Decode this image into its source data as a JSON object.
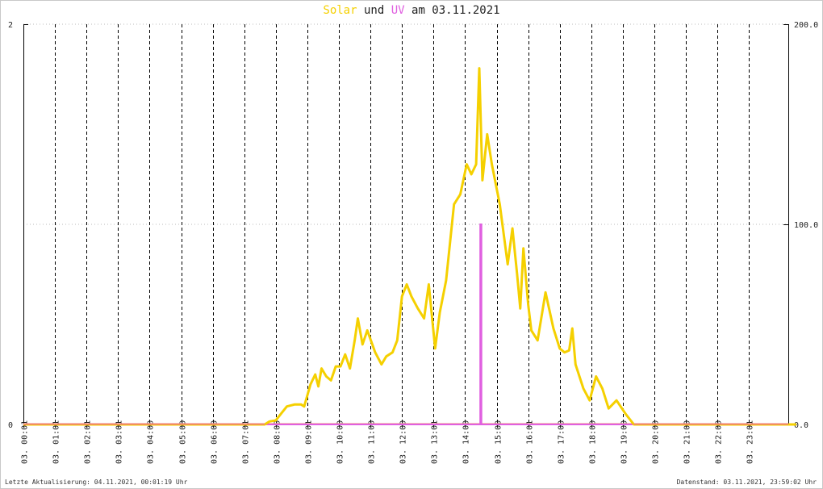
{
  "title_parts": {
    "solar": "Solar",
    "und": "und",
    "uv": "UV",
    "rest": "am 03.11.2021"
  },
  "colors": {
    "solar": "#f5d000",
    "uv": "#e060e0",
    "baseline": "#f08070",
    "grid": "#000000",
    "hgrid": "#bbbbbb"
  },
  "footer": {
    "left": "Letzte Aktualisierung: 04.11.2021, 00:01:19 Uhr",
    "right": "Datenstand: 03.11.2021, 23:59:02 Uhr"
  },
  "chart_data": {
    "type": "line",
    "x_unit": "hour of day",
    "xlim": [
      0,
      24.5
    ],
    "left_axis": {
      "ylim": [
        0,
        2
      ],
      "ticks": [
        "0",
        "2"
      ]
    },
    "right_axis": {
      "ylim": [
        0,
        200
      ],
      "ticks": [
        "0.0",
        "100.0",
        "200.0"
      ]
    },
    "x_tick_labels": [
      "03. 00:01",
      "03. 01:01",
      "03. 02:01",
      "03. 03:01",
      "03. 04:00",
      "03. 05:00",
      "03. 06:00",
      "03. 07:01",
      "03. 08:00",
      "03. 09:01",
      "03. 10:00",
      "03. 11:00",
      "03. 12:00",
      "03. 13:01",
      "03. 14:00",
      "03. 15:00",
      "03. 16:01",
      "03. 17:00",
      "03. 18:00",
      "03. 19:00",
      "03. 20:00",
      "03. 21:00",
      "03. 22:00",
      "03. 23:01"
    ],
    "x_tick_hours": [
      0,
      1,
      2,
      3,
      4,
      5,
      6,
      7,
      8,
      9,
      10,
      11,
      12,
      13,
      14,
      15,
      16,
      17,
      18,
      19,
      20,
      21,
      22,
      23
    ],
    "series": [
      {
        "name": "Solar",
        "axis": "right",
        "points": [
          [
            0,
            0
          ],
          [
            7.65,
            0
          ],
          [
            7.8,
            1.5
          ],
          [
            8.0,
            2
          ],
          [
            8.2,
            6
          ],
          [
            8.35,
            9
          ],
          [
            8.6,
            10
          ],
          [
            8.8,
            10
          ],
          [
            8.9,
            9
          ],
          [
            9.1,
            20
          ],
          [
            9.25,
            25
          ],
          [
            9.35,
            19
          ],
          [
            9.45,
            28
          ],
          [
            9.6,
            24
          ],
          [
            9.75,
            22
          ],
          [
            9.9,
            29
          ],
          [
            10.05,
            29
          ],
          [
            10.2,
            35
          ],
          [
            10.35,
            28
          ],
          [
            10.5,
            42
          ],
          [
            10.6,
            53
          ],
          [
            10.75,
            40
          ],
          [
            10.9,
            47
          ],
          [
            11.15,
            36
          ],
          [
            11.35,
            30
          ],
          [
            11.5,
            34
          ],
          [
            11.7,
            36
          ],
          [
            11.85,
            42
          ],
          [
            12.0,
            64
          ],
          [
            12.15,
            70
          ],
          [
            12.3,
            64
          ],
          [
            12.5,
            58
          ],
          [
            12.7,
            53
          ],
          [
            12.85,
            70
          ],
          [
            13.05,
            38
          ],
          [
            13.2,
            56
          ],
          [
            13.4,
            72
          ],
          [
            13.65,
            110
          ],
          [
            13.85,
            115
          ],
          [
            14.05,
            130
          ],
          [
            14.2,
            125
          ],
          [
            14.35,
            130
          ],
          [
            14.45,
            178
          ],
          [
            14.55,
            122
          ],
          [
            14.7,
            145
          ],
          [
            14.85,
            130
          ],
          [
            15.1,
            110
          ],
          [
            15.35,
            80
          ],
          [
            15.5,
            98
          ],
          [
            15.65,
            75
          ],
          [
            15.75,
            58
          ],
          [
            15.85,
            88
          ],
          [
            16.0,
            60
          ],
          [
            16.1,
            47
          ],
          [
            16.3,
            42
          ],
          [
            16.55,
            66
          ],
          [
            16.8,
            48
          ],
          [
            17.0,
            38
          ],
          [
            17.15,
            36
          ],
          [
            17.3,
            37
          ],
          [
            17.4,
            48
          ],
          [
            17.5,
            30
          ],
          [
            17.75,
            18
          ],
          [
            17.95,
            12
          ],
          [
            18.15,
            24
          ],
          [
            18.35,
            18
          ],
          [
            18.55,
            8
          ],
          [
            18.8,
            12
          ],
          [
            19.1,
            5
          ],
          [
            19.35,
            0
          ],
          [
            24.5,
            0
          ]
        ]
      },
      {
        "name": "UV",
        "axis": "right",
        "points": [
          [
            0,
            0
          ],
          [
            14.48,
            0
          ],
          [
            14.48,
            100
          ],
          [
            14.52,
            100
          ],
          [
            14.52,
            0
          ],
          [
            24.5,
            0
          ]
        ]
      }
    ]
  }
}
